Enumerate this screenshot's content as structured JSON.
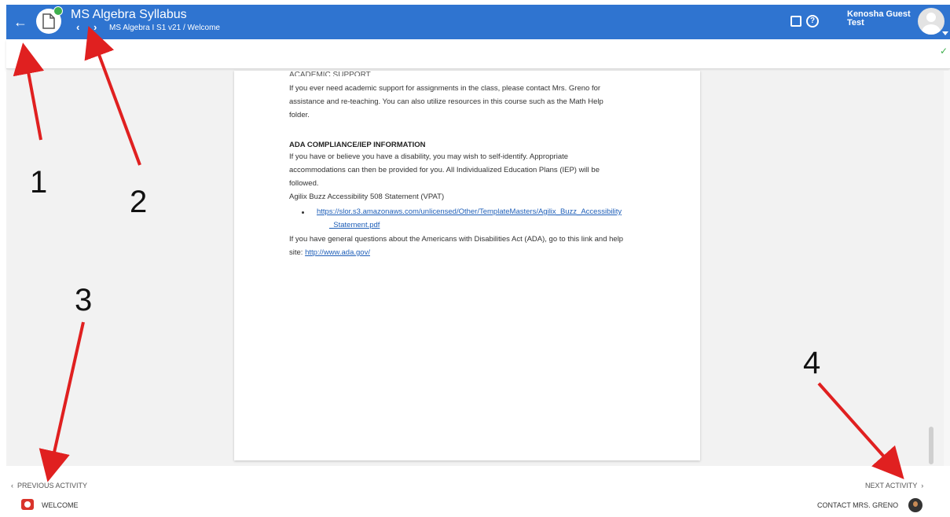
{
  "header": {
    "title": "MS Algebra Syllabus",
    "breadcrumb": "MS Algebra I S1 v21 / Welcome",
    "user_name": "Kenosha Guest\nTest"
  },
  "content": {
    "cut_heading": "ACADEMIC SUPPORT",
    "support_text_1": "If you ever need academic support for assignments in the class, please contact Mrs. Greno for",
    "support_text_2": "assistance and re-teaching. You can also utilize resources in this course such as the Math Help",
    "support_text_3": "folder.",
    "ada_heading": "ADA COMPLIANCE/IEP INFORMATION",
    "ada_text_1": "If you have or believe you have a disability, you may wish to self-identify. Appropriate",
    "ada_text_2": "accommodations can then be provided for you. All Individualized Education Plans (IEP) will be",
    "ada_text_3": "followed.",
    "vpat_text": "Agilix Buzz Accessibility 508 Statement (VPAT)",
    "vpat_link_1": "https://slor.s3.amazonaws.com/unlicensed/Other/TemplateMasters/Agilix_Buzz_Accessibility",
    "vpat_link_2": "_Statement.pdf",
    "ada_general_1": "If you have general questions about the Americans with Disabilities Act (ADA), go to this link and help",
    "ada_general_2": "site: ",
    "ada_link": "http://www.ada.gov/"
  },
  "footer": {
    "prev_label": "PREVIOUS ACTIVITY",
    "next_label": "NEXT ACTIVITY",
    "welcome_label": "WELCOME",
    "contact_label": "CONTACT MRS. GRENO"
  },
  "annotations": [
    "1",
    "2",
    "3",
    "4"
  ],
  "colors": {
    "topbar": "#2f74d0",
    "arrow": "#e02020",
    "check": "#3fb04e"
  },
  "icons": [
    "back-arrow-icon",
    "document-icon",
    "note-icon",
    "help-icon",
    "avatar-icon"
  ]
}
